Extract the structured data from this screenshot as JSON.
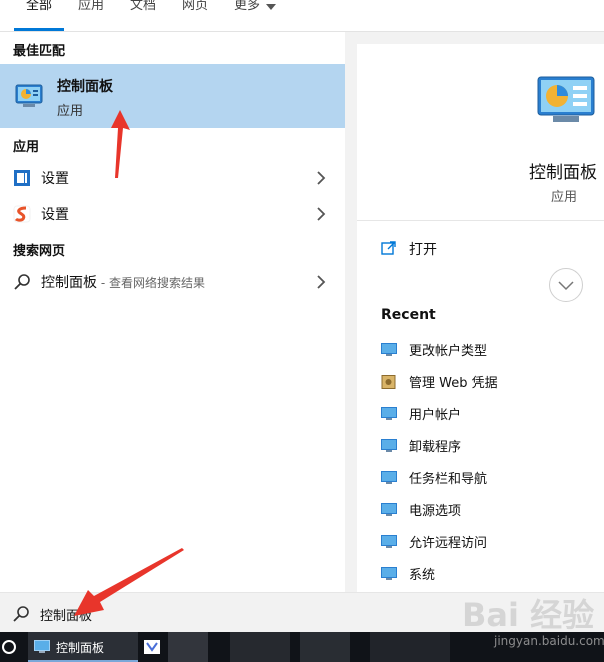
{
  "tabs": [
    {
      "label": "全部",
      "active": true
    },
    {
      "label": "应用"
    },
    {
      "label": "文档"
    },
    {
      "label": "网页"
    },
    {
      "label": "更多"
    }
  ],
  "left": {
    "best_match_title": "最佳匹配",
    "best_match": {
      "title": "控制面板",
      "subtitle": "应用"
    },
    "apps_title": "应用",
    "apps": [
      {
        "label": "设置",
        "icon": "settings-blue-icon"
      },
      {
        "label": "设置",
        "icon": "settings-orange-icon"
      }
    ],
    "web_title": "搜索网页",
    "web_item": {
      "label": "控制面板",
      "suffix": " - 查看网络搜索结果"
    }
  },
  "right": {
    "title": "控制面板",
    "subtitle": "应用",
    "open_label": "打开",
    "recent_title": "Recent",
    "recent": [
      "更改帐户类型",
      "管理 Web 凭据",
      "用户帐户",
      "卸载程序",
      "任务栏和导航",
      "电源选项",
      "允许远程访问",
      "系统"
    ]
  },
  "search": {
    "value": "控制面板"
  },
  "taskbar": {
    "app_label": "控制面板"
  },
  "watermark": {
    "text": "Bai 经验",
    "sub": "jingyan.baidu.com"
  },
  "colors": {
    "accent": "#0078d7",
    "selection": "#b4d5f0",
    "taskbar": "#101318",
    "arrow": "#e8352b"
  }
}
